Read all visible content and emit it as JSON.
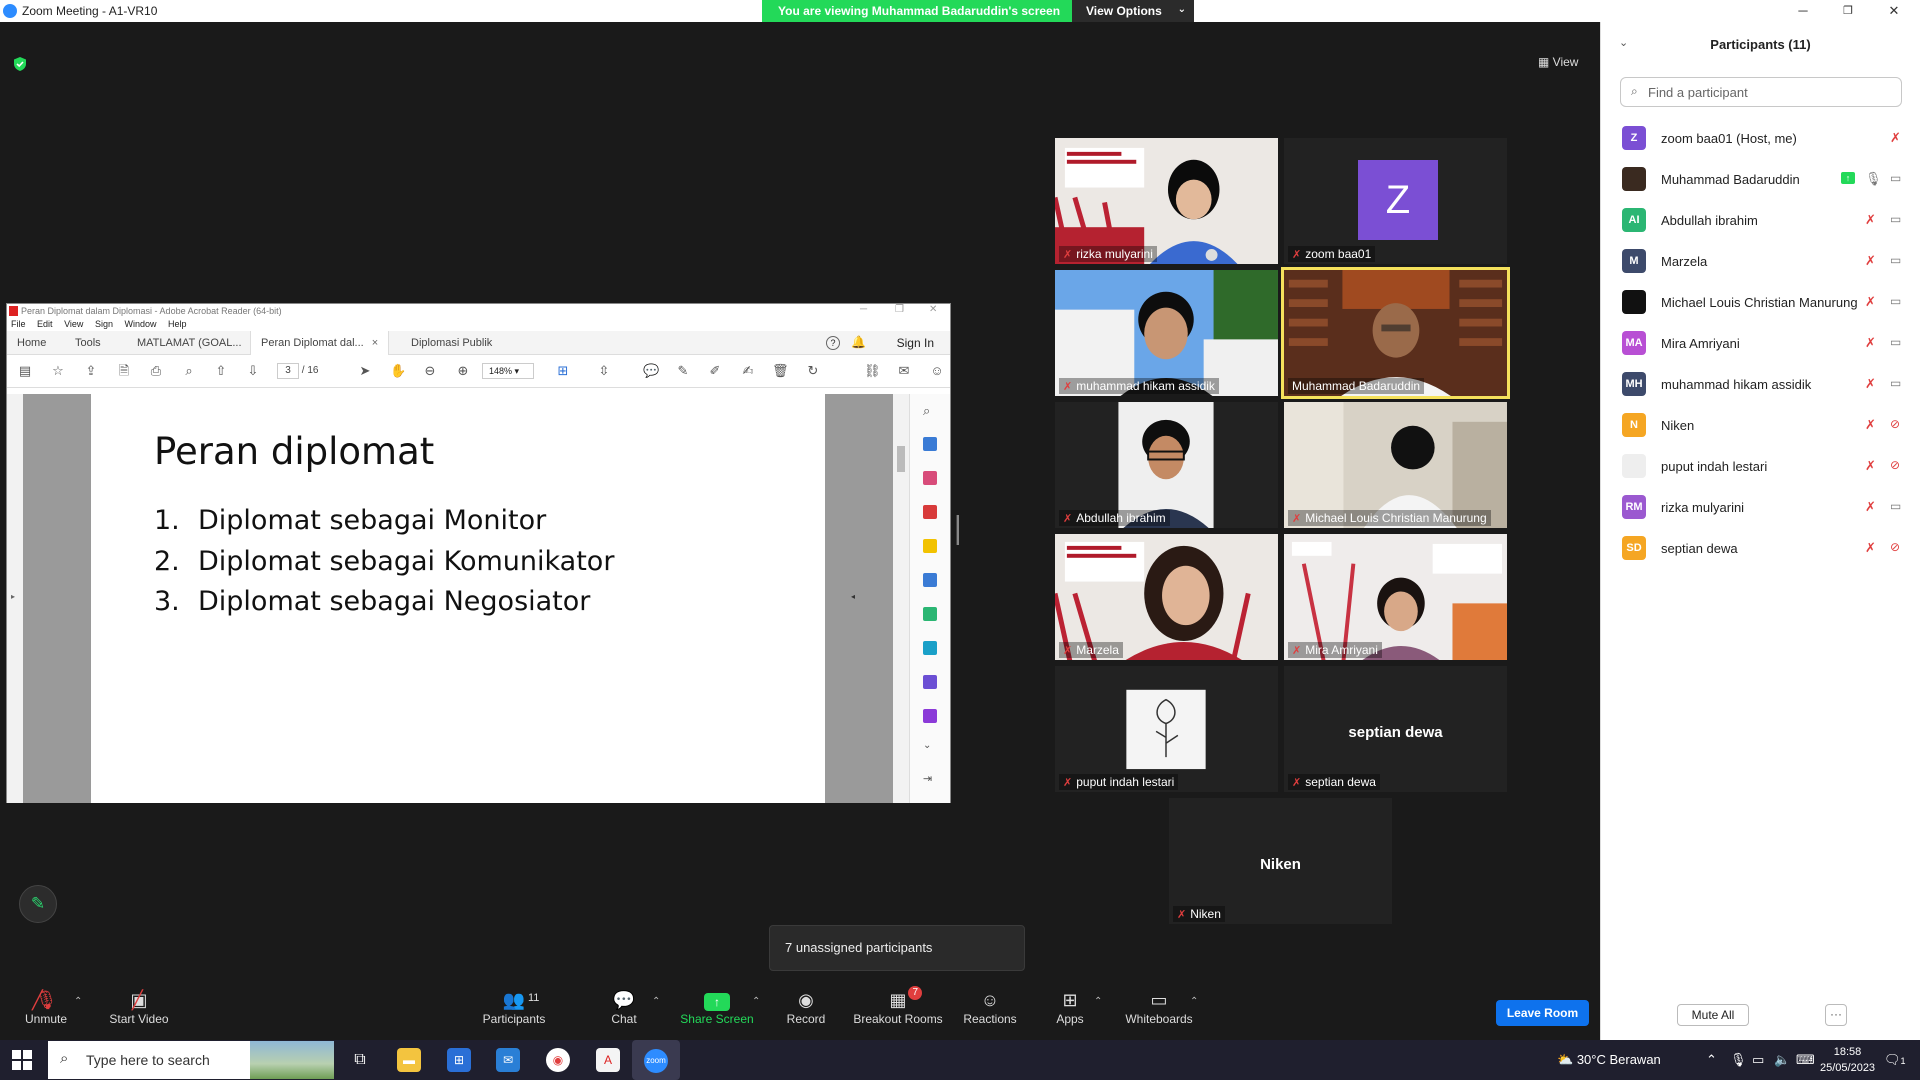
{
  "window": {
    "title": "Zoom Meeting - A1-VR10",
    "minimize": "─",
    "restore": "❐",
    "close": "✕"
  },
  "banner": {
    "viewing_text": "You are viewing Muhammad Badaruddin's screen",
    "view_options_label": "View Options"
  },
  "top_right": {
    "view_label": "View"
  },
  "acrobat": {
    "title": "Peran Diplomat dalam Diplomasi - Adobe Acrobat Reader (64-bit)",
    "menu": [
      "File",
      "Edit",
      "View",
      "Sign",
      "Window",
      "Help"
    ],
    "nav": {
      "home": "Home",
      "tools": "Tools"
    },
    "tabs": [
      "MATLAMAT (GOAL...",
      "Peran Diplomat dal...",
      "Diplomasi Publik"
    ],
    "sign_in": "Sign In",
    "page_current": "3",
    "page_total": "/ 16",
    "zoom": "148%",
    "slide": {
      "title": "Peran diplomat",
      "items": [
        {
          "num": "1.",
          "text": "Diplomat sebagai Monitor"
        },
        {
          "num": "2.",
          "text": "Diplomat sebagai Komunikator"
        },
        {
          "num": "3.",
          "text": "Diplomat sebagai Negosiator"
        }
      ]
    }
  },
  "tiles": [
    {
      "name": "rizka mulyarini"
    },
    {
      "name": "zoom baa01",
      "avatar": "Z"
    },
    {
      "name": "muhammad hikam assidik"
    },
    {
      "name": "Muhammad Badaruddin"
    },
    {
      "name": "Abdullah ibrahim"
    },
    {
      "name": "Michael Louis Christian Manurung"
    },
    {
      "name": "Marzela"
    },
    {
      "name": "Mira Amriyani"
    },
    {
      "name": "puput indah lestari"
    },
    {
      "name": "septian dewa",
      "center": "septian dewa"
    },
    {
      "name": "Niken",
      "center": "Niken"
    }
  ],
  "unassigned": "7 unassigned participants",
  "toolbar": {
    "unmute": "Unmute",
    "start_video": "Start Video",
    "participants": "Participants",
    "participants_count": "11",
    "chat": "Chat",
    "share_screen": "Share Screen",
    "record": "Record",
    "breakout_rooms": "Breakout Rooms",
    "breakout_badge": "7",
    "reactions": "Reactions",
    "apps": "Apps",
    "whiteboards": "Whiteboards",
    "leave_room": "Leave Room"
  },
  "panel": {
    "title": "Participants (11)",
    "search_placeholder": "Find a participant",
    "participants": [
      {
        "initials": "Z",
        "name": "zoom baa01 (Host, me)",
        "color": "#7b4fd4",
        "mic": "muted",
        "cam": "none"
      },
      {
        "initials": "",
        "name": "Muhammad Badaruddin",
        "color": "#3a2a20",
        "mic": "on",
        "cam": "on",
        "sharing": true
      },
      {
        "initials": "AI",
        "name": "Abdullah ibrahim",
        "color": "#2bb673",
        "mic": "muted",
        "cam": "on"
      },
      {
        "initials": "M",
        "name": "Marzela",
        "color": "#3d4a6b",
        "mic": "muted",
        "cam": "on"
      },
      {
        "initials": "",
        "name": "Michael Louis Christian Manurung",
        "color": "#111111",
        "mic": "muted",
        "cam": "on"
      },
      {
        "initials": "MA",
        "name": "Mira Amriyani",
        "color": "#b84fd4",
        "mic": "muted",
        "cam": "on"
      },
      {
        "initials": "MH",
        "name": "muhammad hikam assidik",
        "color": "#3d4a6b",
        "mic": "muted",
        "cam": "on"
      },
      {
        "initials": "N",
        "name": "Niken",
        "color": "#f5a623",
        "mic": "muted",
        "cam": "off"
      },
      {
        "initials": "",
        "name": "puput indah lestari",
        "color": "#eeeeee",
        "mic": "muted",
        "cam": "off"
      },
      {
        "initials": "RM",
        "name": "rizka mulyarini",
        "color": "#9b59d0",
        "mic": "muted",
        "cam": "on"
      },
      {
        "initials": "SD",
        "name": "septian dewa",
        "color": "#f5a623",
        "mic": "muted",
        "cam": "off"
      }
    ],
    "mute_all": "Mute All",
    "more": "···"
  },
  "taskbar": {
    "search_placeholder": "Type here to search",
    "weather": "30°C  Berawan",
    "time": "18:58",
    "date": "25/05/2023",
    "notif_count": "1"
  },
  "colors": {
    "zoom_green": "#23d959",
    "zoom_blue": "#0e72ed",
    "active_speaker": "#f5e15c",
    "muted_red": "#e03e3e"
  }
}
